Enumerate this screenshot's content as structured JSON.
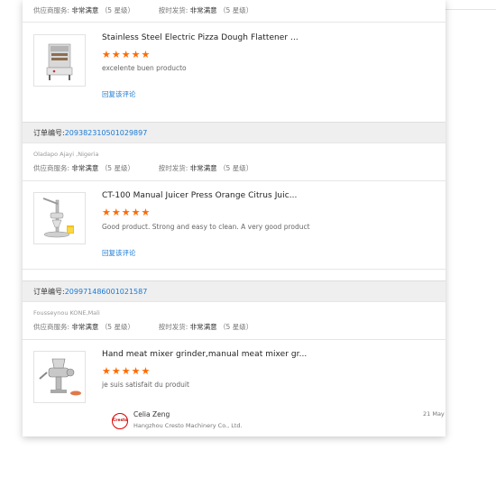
{
  "service_labels": {
    "supplier_service": "供应商服务:",
    "on_time_shipping": "按时发货:",
    "rating": "非常满意",
    "level": "（5 星级）"
  },
  "order_label": "订单编号:",
  "reply_label": "回复该评论",
  "orders": [
    {
      "product_title": "Stainless Steel Electric Pizza Dough Flattener ...",
      "stars": "★★★★★",
      "review": "excelente buen producto",
      "product_icon": "dough-flattener-machine"
    },
    {
      "order_number": "209382310501029897",
      "buyer": "Oladapo Ajayi ,Nigeria",
      "product_title": "CT-100 Manual Juicer Press Orange Citrus Juic...",
      "stars": "★★★★★",
      "review": "Good product. Strong and easy to clean. A very good product",
      "product_icon": "manual-juicer-press"
    },
    {
      "order_number": "209971486001021587",
      "buyer": "Fousseynou KONE,Mali",
      "product_title": "Hand meat mixer grinder,manual meat mixer gr...",
      "stars": "★★★★★",
      "review": "je suis satisfait du produit",
      "product_icon": "manual-meat-grinder"
    }
  ],
  "seller_reply": {
    "logo_text": "Cresto",
    "name": "Celia Zeng",
    "company": "Hangzhou Cresto Machinery Co., Ltd.",
    "date": "21 May"
  },
  "colors": {
    "accent_link": "#1a7ad4",
    "star": "#ff6a00",
    "header_bg": "#efefef"
  }
}
